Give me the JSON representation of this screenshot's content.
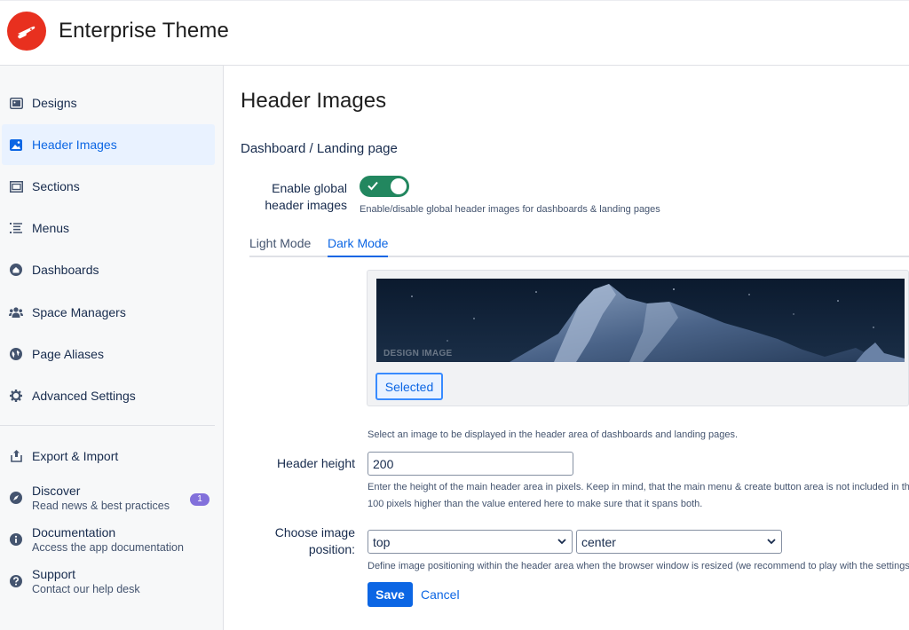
{
  "app": {
    "title": "Enterprise Theme",
    "brand_color": "#e8301f"
  },
  "sidebar": {
    "items": [
      {
        "label": "Designs",
        "icon": "image-frame-icon"
      },
      {
        "label": "Header Images",
        "icon": "image-icon",
        "active": true
      },
      {
        "label": "Sections",
        "icon": "sections-icon"
      },
      {
        "label": "Menus",
        "icon": "menu-list-icon"
      },
      {
        "label": "Dashboards",
        "icon": "home-icon"
      },
      {
        "label": "Space Managers",
        "icon": "people-icon"
      },
      {
        "label": "Page Aliases",
        "icon": "globe-icon"
      },
      {
        "label": "Advanced Settings",
        "icon": "gear-icon"
      }
    ],
    "secondary": [
      {
        "label": "Export & Import",
        "icon": "upload-icon"
      },
      {
        "label": "Discover",
        "sub": "Read news & best practices",
        "icon": "compass-icon",
        "badge": "1"
      },
      {
        "label": "Documentation",
        "sub": "Access the app documentation",
        "icon": "info-icon"
      },
      {
        "label": "Support",
        "sub": "Contact our help desk",
        "icon": "question-icon"
      }
    ]
  },
  "main": {
    "title": "Header Images",
    "section_title": "Dashboard / Landing page",
    "enable": {
      "label_line1": "Enable global",
      "label_line2": "header images",
      "help": "Enable/disable global header images for dashboards & landing pages",
      "on": true
    },
    "tabs": [
      {
        "label": "Light Mode",
        "active": false
      },
      {
        "label": "Dark Mode",
        "active": true
      }
    ],
    "image": {
      "caption": "DESIGN IMAGE",
      "selected_label": "Selected",
      "help": "Select an image to be displayed in the header area of dashboards and landing pages."
    },
    "header_height": {
      "label": "Header height",
      "value": "200",
      "help_line1": "Enter the height of the main header area in pixels. Keep in mind, that the main menu & create button area is not included in thi",
      "help_line2": "100 pixels higher than the value entered here to make sure that it spans both."
    },
    "position": {
      "label_line1": "Choose image",
      "label_line2": "position:",
      "vertical": "top",
      "horizontal": "center",
      "help": "Define image positioning within the header area when the browser window is resized (we recommend to play with the settings"
    },
    "save_label": "Save",
    "cancel_label": "Cancel",
    "accent_color": "#0c66e4",
    "toggle_color": "#22875f"
  }
}
